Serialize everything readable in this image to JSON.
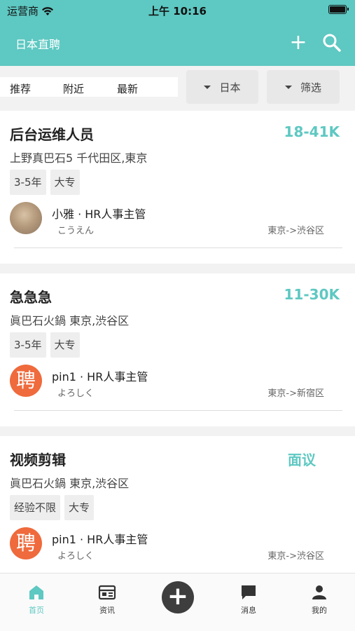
{
  "status_bar": {
    "carrier": "运营商",
    "time": "上午 10:16"
  },
  "nav": {
    "title": "日本直聘"
  },
  "filters": {
    "tabs": [
      "推荐",
      "附近",
      "最新"
    ],
    "region_label": "日本",
    "filter_label": "筛选"
  },
  "jobs": [
    {
      "title": "后台运维人员",
      "salary": "18-41K",
      "location": "上野真巴石5 千代田区,東京",
      "tags": [
        "3-5年",
        "大专"
      ],
      "hr": "小雅 · HR人事主管",
      "greeting": "こうえん",
      "route": "東京->渋谷区",
      "avatar": "photo"
    },
    {
      "title": "急急急",
      "salary": "11-30K",
      "location": "眞巴石火鍋 東京,渋谷区",
      "tags": [
        "3-5年",
        "大专"
      ],
      "hr": "pin1 · HR人事主管",
      "greeting": "よろしく",
      "route": "東京->新宿区",
      "avatar": "聘"
    },
    {
      "title": "视频剪辑",
      "salary": "面议",
      "location": "眞巴石火鍋 東京,渋谷区",
      "tags": [
        "经验不限",
        "大专"
      ],
      "hr": "pin1 · HR人事主管",
      "greeting": "よろしく",
      "route": "東京->渋谷区",
      "avatar": "聘"
    }
  ],
  "tabbar": {
    "items": [
      "首页",
      "资讯",
      "消息",
      "我的"
    ]
  },
  "colors": {
    "accent": "#5ec8c2",
    "logo": "#ef6a3c"
  }
}
